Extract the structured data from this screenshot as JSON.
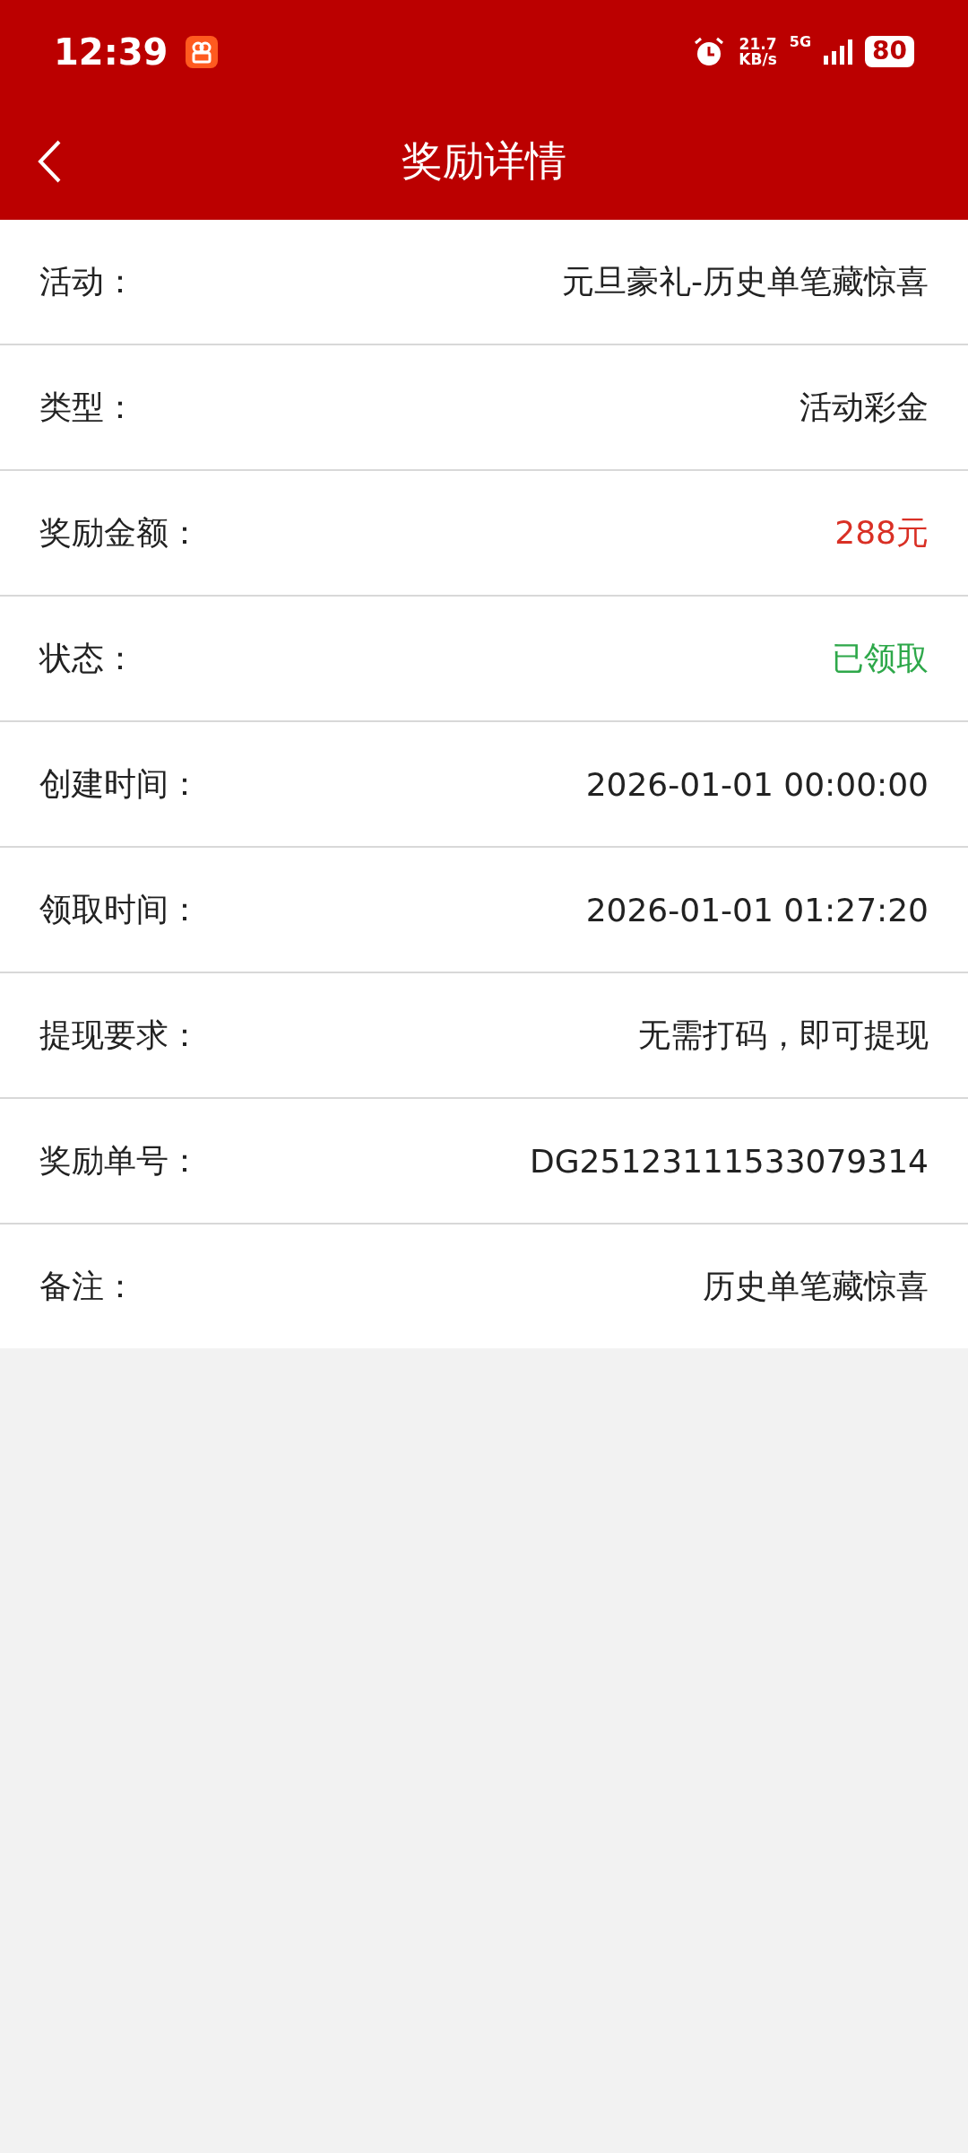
{
  "status_bar": {
    "time": "12:39",
    "speed_value": "21.7",
    "speed_unit": "KB/s",
    "network": "5G",
    "battery": "80"
  },
  "nav": {
    "title": "奖励详情"
  },
  "rows": [
    {
      "label": "活动：",
      "value": "元旦豪礼-历史单笔藏惊喜",
      "color": "#222222"
    },
    {
      "label": "类型：",
      "value": "活动彩金",
      "color": "#222222"
    },
    {
      "label": "奖励金额：",
      "value": "288元",
      "color": "#d93025"
    },
    {
      "label": "状态：",
      "value": "已领取",
      "color": "#2ea84a"
    },
    {
      "label": "创建时间：",
      "value": "2026-01-01 00:00:00",
      "color": "#222222"
    },
    {
      "label": "领取时间：",
      "value": "2026-01-01 01:27:20",
      "color": "#222222"
    },
    {
      "label": "提现要求：",
      "value": "无需打码，即可提现",
      "color": "#222222"
    },
    {
      "label": "奖励单号：",
      "value": "DG25123111533079314",
      "color": "#222222"
    },
    {
      "label": "备注：",
      "value": "历史单笔藏惊喜",
      "color": "#222222"
    }
  ]
}
